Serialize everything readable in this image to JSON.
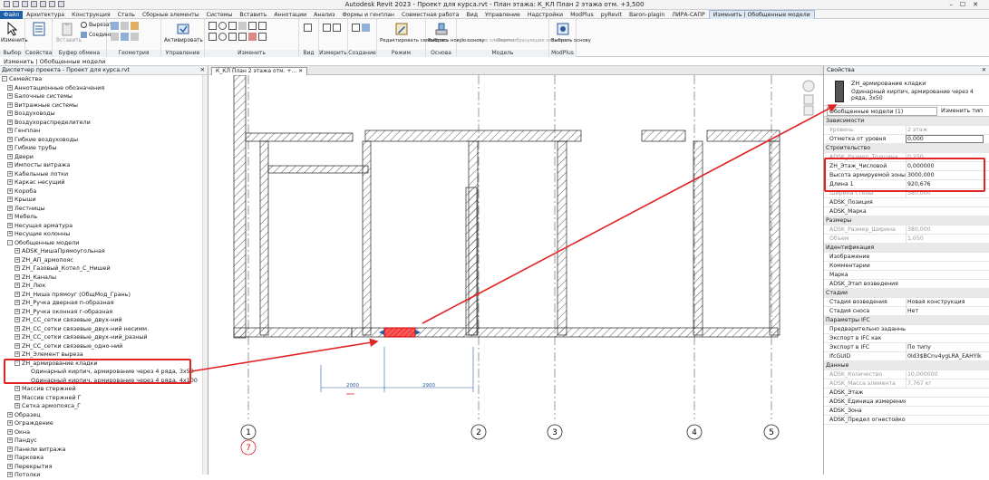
{
  "titlebar": {
    "title": "Autodesk Revit 2023 - Проект для курса.rvt - План этажа: К_КЛ План 2 этажа отм. +3,500"
  },
  "ribbon_tabs": [
    {
      "label": "Файл",
      "kind": "file"
    },
    {
      "label": "Архитектура"
    },
    {
      "label": "Конструкция"
    },
    {
      "label": "Сталь"
    },
    {
      "label": "Сборные элементы"
    },
    {
      "label": "Системы"
    },
    {
      "label": "Вставить"
    },
    {
      "label": "Аннотации"
    },
    {
      "label": "Анализ"
    },
    {
      "label": "Формы и генплан"
    },
    {
      "label": "Совместная работа"
    },
    {
      "label": "Вид"
    },
    {
      "label": "Управление"
    },
    {
      "label": "Надстройки"
    },
    {
      "label": "ModPlus"
    },
    {
      "label": "pyRevit"
    },
    {
      "label": "Baron-plagin"
    },
    {
      "label": "ЛИРА-САПР"
    },
    {
      "label": "Изменить | Обобщенные модели",
      "kind": "active"
    }
  ],
  "ribbon": {
    "modify": "Изменить",
    "paste": "Вставить",
    "cut": "Вырезать",
    "join": "Соединить",
    "activate": "Активировать",
    "edit_family": "Редактировать семейство",
    "pick_base": "Выбрать новую основу",
    "dependent": "Зависимые элементы",
    "formwork": "Формообразующие элементы",
    "pick_base2": "Выбрать основу",
    "groups": {
      "select": "Выбор",
      "properties": "Свойства",
      "clipboard": "Буфер обмена",
      "geometry": "Геометрия",
      "control": "Управление",
      "modify": "Изменить",
      "view": "Вид",
      "measure": "Измерить",
      "create": "Создание",
      "mode": "Режим",
      "host": "Основа",
      "model": "Модель",
      "modplus": "ModPlus"
    }
  },
  "context_bar": "Изменить | Обобщенные модели",
  "project_browser": {
    "title": "Диспетчер проекта - Проект для курса.rvt",
    "root": "Семейства",
    "items": [
      {
        "label": "Аннотационные обозначения",
        "level": 1,
        "pm": "+"
      },
      {
        "label": "Балочные системы",
        "level": 1,
        "pm": "+"
      },
      {
        "label": "Витражные системы",
        "level": 1,
        "pm": "+"
      },
      {
        "label": "Воздуховоды",
        "level": 1,
        "pm": "+"
      },
      {
        "label": "Воздухораспределители",
        "level": 1,
        "pm": "+"
      },
      {
        "label": "Генплан",
        "level": 1,
        "pm": "+"
      },
      {
        "label": "Гибкие воздуховоды",
        "level": 1,
        "pm": "+"
      },
      {
        "label": "Гибкие трубы",
        "level": 1,
        "pm": "+"
      },
      {
        "label": "Двери",
        "level": 1,
        "pm": "+"
      },
      {
        "label": "Импосты витража",
        "level": 1,
        "pm": "+"
      },
      {
        "label": "Кабельные лотки",
        "level": 1,
        "pm": "+"
      },
      {
        "label": "Каркас несущий",
        "level": 1,
        "pm": "+"
      },
      {
        "label": "Коробa",
        "level": 1,
        "pm": "+"
      },
      {
        "label": "Крыши",
        "level": 1,
        "pm": "+"
      },
      {
        "label": "Лестницы",
        "level": 1,
        "pm": "+"
      },
      {
        "label": "Мебель",
        "level": 1,
        "pm": "+"
      },
      {
        "label": "Несущая арматура",
        "level": 1,
        "pm": "+"
      },
      {
        "label": "Несущие колонны",
        "level": 1,
        "pm": "+"
      },
      {
        "label": "Обобщенные модели",
        "level": 1,
        "pm": "-"
      },
      {
        "label": "ADSK_НишаПрямоугольная",
        "level": 2,
        "pm": "+"
      },
      {
        "label": "ZH_АП_армопояс",
        "level": 2,
        "pm": "+"
      },
      {
        "label": "ZH_Газовый_Котел_С_Нишей",
        "level": 2,
        "pm": "+"
      },
      {
        "label": "ZH_Каналы",
        "level": 2,
        "pm": "+"
      },
      {
        "label": "ZH_Люк",
        "level": 2,
        "pm": "+"
      },
      {
        "label": "ZH_Ниша прямоуг (ОбщМод_Грань)",
        "level": 2,
        "pm": "+"
      },
      {
        "label": "ZH_Ручка дверная п-образная",
        "level": 2,
        "pm": "+"
      },
      {
        "label": "ZH_Ручка оконная г-образная",
        "level": 2,
        "pm": "+"
      },
      {
        "label": "ZH_СС_сетки связевые_двух-ний",
        "level": 2,
        "pm": "+"
      },
      {
        "label": "ZH_СС_сетки связевые_двух-ний несимм.",
        "level": 2,
        "pm": "+"
      },
      {
        "label": "ZH_СС_сетки связевые_двух-ний_разный",
        "level": 2,
        "pm": "+"
      },
      {
        "label": "ZH_СС_сетки связевые_одно-ний",
        "level": 2,
        "pm": "+"
      },
      {
        "label": "ZH_Элемент выреза",
        "level": 2,
        "pm": "+"
      },
      {
        "label": "ZH_армирование кладки",
        "level": 2,
        "pm": "-"
      },
      {
        "label": "Одинарный кирпич, армирование через 4 ряда, 3х50",
        "level": 3,
        "pm": ""
      },
      {
        "label": "Одинарный кирпич, армирование через 4 ряда, 4х100",
        "level": 3,
        "pm": ""
      },
      {
        "label": "Массив стержней",
        "level": 2,
        "pm": "+"
      },
      {
        "label": "Массив стержней Г",
        "level": 2,
        "pm": "+"
      },
      {
        "label": "Сетка армопояса_Г",
        "level": 2,
        "pm": "+"
      },
      {
        "label": "Образец",
        "level": 1,
        "pm": "+"
      },
      {
        "label": "Ограждение",
        "level": 1,
        "pm": "+"
      },
      {
        "label": "Окна",
        "level": 1,
        "pm": "+"
      },
      {
        "label": "Пандус",
        "level": 1,
        "pm": "+"
      },
      {
        "label": "Панели витража",
        "level": 1,
        "pm": "+"
      },
      {
        "label": "Парковка",
        "level": 1,
        "pm": "+"
      },
      {
        "label": "Перекрытия",
        "level": 1,
        "pm": "+"
      },
      {
        "label": "Потолки",
        "level": 1,
        "pm": "+"
      }
    ]
  },
  "view_tab": "К_КЛ План 2 этажа отм. +...",
  "canvas": {
    "dim1": "2000",
    "dim2": "2900",
    "grids": [
      "1",
      "7",
      "2",
      "3",
      "4",
      "5"
    ]
  },
  "properties": {
    "title": "Свойства",
    "type_name": "ZH_армирование кладки",
    "type_sub": "Одинарный кирпич, армирование через 4 ряда, 3х50",
    "filter": "Обобщенные модели (1)",
    "edit_type": "Изменить тип",
    "rows": [
      {
        "kind": "cat",
        "k": "Зависимости"
      },
      {
        "kind": "gray",
        "k": "Уровень",
        "v": "2 этаж"
      },
      {
        "kind": "norm",
        "k": "Отметка от уровня",
        "v": "0,000",
        "input": true
      },
      {
        "kind": "cat",
        "k": "Строительство"
      },
      {
        "kind": "gray",
        "k": "ADSK_Размер_Толщина",
        "v": "0,250"
      },
      {
        "kind": "norm",
        "k": "ZH_Этаж_Числовой",
        "v": "0,000000"
      },
      {
        "kind": "norm",
        "k": "Высота армируемой зоны",
        "v": "3000,000"
      },
      {
        "kind": "norm",
        "k": "Длина 1",
        "v": "920,676"
      },
      {
        "kind": "gray",
        "k": "Ширина стены",
        "v": "380,000"
      },
      {
        "kind": "norm",
        "k": "ADSK_Позиция",
        "v": ""
      },
      {
        "kind": "norm",
        "k": "ADSK_Марка",
        "v": ""
      },
      {
        "kind": "cat",
        "k": "Размеры"
      },
      {
        "kind": "gray",
        "k": "ADSK_Размер_Ширина",
        "v": "380,000"
      },
      {
        "kind": "gray",
        "k": "Объем",
        "v": "1,050"
      },
      {
        "kind": "cat",
        "k": "Идентификация"
      },
      {
        "kind": "norm",
        "k": "Изображение",
        "v": ""
      },
      {
        "kind": "norm",
        "k": "Комментарии",
        "v": ""
      },
      {
        "kind": "norm",
        "k": "Марка",
        "v": ""
      },
      {
        "kind": "norm",
        "k": "ADSK_Этап возведения",
        "v": ""
      },
      {
        "kind": "cat",
        "k": "Стадии"
      },
      {
        "kind": "norm",
        "k": "Стадия возведения",
        "v": "Новая конструкция"
      },
      {
        "kind": "norm",
        "k": "Стадия сноса",
        "v": "Нет"
      },
      {
        "kind": "cat",
        "k": "Параметры IFC"
      },
      {
        "kind": "norm",
        "k": "Предварительно заданны...",
        "v": ""
      },
      {
        "kind": "norm",
        "k": "Экспорт в IFC как",
        "v": ""
      },
      {
        "kind": "norm",
        "k": "Экспорт в IFC",
        "v": "По типу"
      },
      {
        "kind": "norm",
        "k": "IfcGUID",
        "v": "0Id3$BCnv4ygLRA_EAHYik"
      },
      {
        "kind": "cat",
        "k": "Данные"
      },
      {
        "kind": "gray",
        "k": "ADSK_Количество",
        "v": "10,000000"
      },
      {
        "kind": "gray",
        "k": "ADSK_Масса элемента",
        "v": "7,767 кг"
      },
      {
        "kind": "norm",
        "k": "ADSK_Этаж",
        "v": ""
      },
      {
        "kind": "norm",
        "k": "ADSK_Единица измерения",
        "v": ""
      },
      {
        "kind": "norm",
        "k": "ADSK_Зона",
        "v": ""
      },
      {
        "kind": "norm",
        "k": "ADSK_Предел огнестойкос...",
        "v": ""
      }
    ]
  },
  "colors": {
    "highlight": "#e02424",
    "file_tab": "#1f5fa8"
  }
}
